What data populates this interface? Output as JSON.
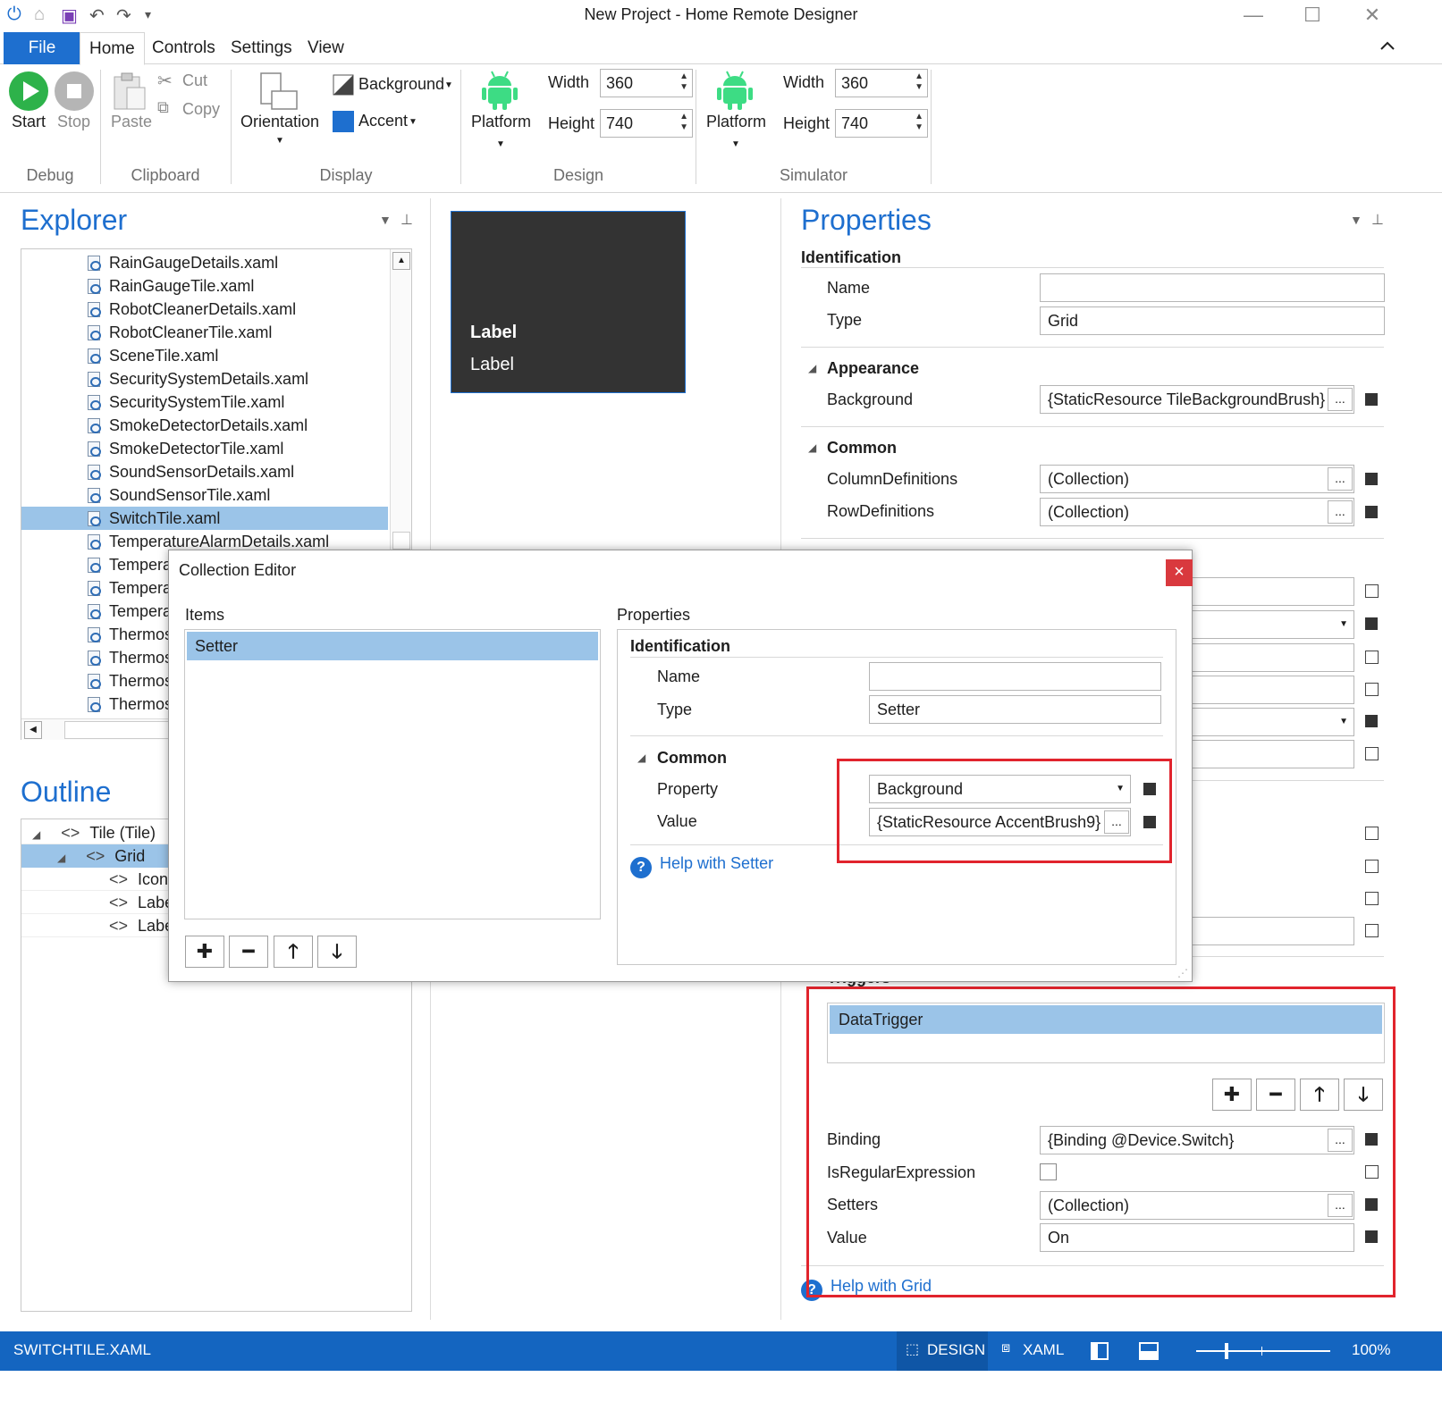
{
  "window": {
    "title": "New Project - Home Remote Designer",
    "minimize_label": "—",
    "maximize_label": "☐",
    "close_label": "✕"
  },
  "menu": {
    "file": "File",
    "tabs": [
      "Home",
      "Controls",
      "Settings",
      "View"
    ],
    "collapse_glyph": "^"
  },
  "ribbon": {
    "debug": {
      "start": "Start",
      "stop": "Stop",
      "group": "Debug"
    },
    "clipboard": {
      "paste": "Paste",
      "cut": "Cut",
      "copy": "Copy",
      "group": "Clipboard"
    },
    "display": {
      "orientation": "Orientation",
      "background": "Background",
      "accent": "Accent",
      "group": "Display"
    },
    "design": {
      "platform": "Platform",
      "width_label": "Width",
      "width": "360",
      "height_label": "Height",
      "height": "740",
      "group": "Design"
    },
    "simulator": {
      "platform": "Platform",
      "width_label": "Width",
      "width": "360",
      "height_label": "Height",
      "height": "740",
      "group": "Simulator"
    },
    "accent_color": "#1e6fcf",
    "android_color": "#3ddc84"
  },
  "explorer": {
    "title": "Explorer",
    "files": [
      "RainGaugeDetails.xaml",
      "RainGaugeTile.xaml",
      "RobotCleanerDetails.xaml",
      "RobotCleanerTile.xaml",
      "SceneTile.xaml",
      "SecuritySystemDetails.xaml",
      "SecuritySystemTile.xaml",
      "SmokeDetectorDetails.xaml",
      "SmokeDetectorTile.xaml",
      "SoundSensorDetails.xaml",
      "SoundSensorTile.xaml",
      "SwitchTile.xaml",
      "TemperatureAlarmDetails.xaml",
      "Tempera",
      "Tempera",
      "Tempera",
      "Thermos",
      "Thermos",
      "Thermos",
      "Thermos"
    ],
    "selected_index": 11
  },
  "outline": {
    "title": "Outline",
    "items": [
      {
        "label": "Tile (Tile)"
      },
      {
        "label": "Grid"
      },
      {
        "label": "IconE"
      },
      {
        "label": "Labe"
      },
      {
        "label": "Labe"
      }
    ]
  },
  "preview": {
    "label_bold": "Label",
    "label": "Label"
  },
  "properties": {
    "title": "Properties",
    "identification": "Identification",
    "name_label": "Name",
    "name_value": "",
    "type_label": "Type",
    "type_value": "Grid",
    "appearance": "Appearance",
    "background_label": "Background",
    "background_value": "{StaticResource TileBackgroundBrush}",
    "common": "Common",
    "columndefs_label": "ColumnDefinitions",
    "columndefs_value": "(Collection)",
    "rowdefs_label": "RowDefinitions",
    "rowdefs_value": "(Collection)",
    "triggers": "Triggers",
    "trigger_item": "DataTrigger",
    "binding_label": "Binding",
    "binding_value": "{Binding @Device.Switch}",
    "isregex_label": "IsRegularExpression",
    "setters_label": "Setters",
    "setters_value": "(Collection)",
    "value_label": "Value",
    "value_value": "On",
    "help": "Help with Grid"
  },
  "collection_editor": {
    "title": "Collection Editor",
    "items_label": "Items",
    "items": [
      "Setter"
    ],
    "properties_label": "Properties",
    "identification": "Identification",
    "name_label": "Name",
    "name_value": "",
    "type_label": "Type",
    "type_value": "Setter",
    "common": "Common",
    "property_label": "Property",
    "property_value": "Background",
    "value_label": "Value",
    "value_value": "{StaticResource AccentBrush9}",
    "help": "Help with Setter",
    "close": "×",
    "buttons": [
      "+",
      "−",
      "↑",
      "↓"
    ]
  },
  "statusbar": {
    "file": "SWITCHTILE.XAML",
    "design": "DESIGN",
    "xaml": "XAML",
    "zoom": "100%"
  },
  "dots": "..."
}
